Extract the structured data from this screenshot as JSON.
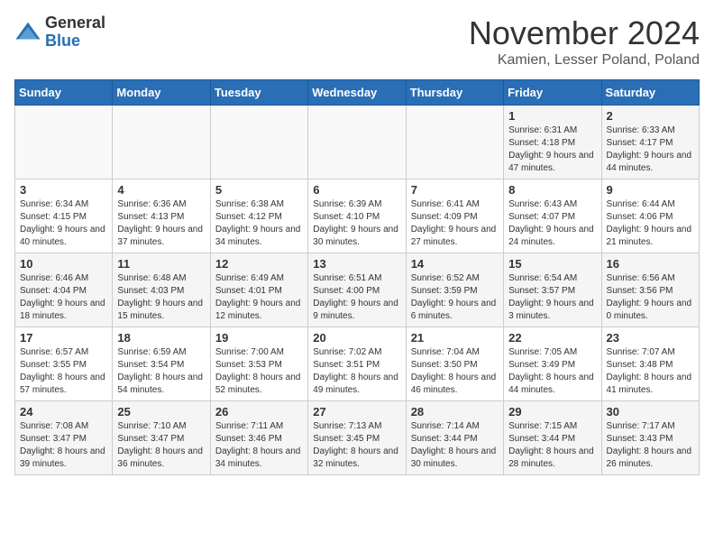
{
  "header": {
    "logo_general": "General",
    "logo_blue": "Blue",
    "month_title": "November 2024",
    "location": "Kamien, Lesser Poland, Poland"
  },
  "days_of_week": [
    "Sunday",
    "Monday",
    "Tuesday",
    "Wednesday",
    "Thursday",
    "Friday",
    "Saturday"
  ],
  "weeks": [
    [
      {
        "day": "",
        "info": ""
      },
      {
        "day": "",
        "info": ""
      },
      {
        "day": "",
        "info": ""
      },
      {
        "day": "",
        "info": ""
      },
      {
        "day": "",
        "info": ""
      },
      {
        "day": "1",
        "info": "Sunrise: 6:31 AM\nSunset: 4:18 PM\nDaylight: 9 hours and 47 minutes."
      },
      {
        "day": "2",
        "info": "Sunrise: 6:33 AM\nSunset: 4:17 PM\nDaylight: 9 hours and 44 minutes."
      }
    ],
    [
      {
        "day": "3",
        "info": "Sunrise: 6:34 AM\nSunset: 4:15 PM\nDaylight: 9 hours and 40 minutes."
      },
      {
        "day": "4",
        "info": "Sunrise: 6:36 AM\nSunset: 4:13 PM\nDaylight: 9 hours and 37 minutes."
      },
      {
        "day": "5",
        "info": "Sunrise: 6:38 AM\nSunset: 4:12 PM\nDaylight: 9 hours and 34 minutes."
      },
      {
        "day": "6",
        "info": "Sunrise: 6:39 AM\nSunset: 4:10 PM\nDaylight: 9 hours and 30 minutes."
      },
      {
        "day": "7",
        "info": "Sunrise: 6:41 AM\nSunset: 4:09 PM\nDaylight: 9 hours and 27 minutes."
      },
      {
        "day": "8",
        "info": "Sunrise: 6:43 AM\nSunset: 4:07 PM\nDaylight: 9 hours and 24 minutes."
      },
      {
        "day": "9",
        "info": "Sunrise: 6:44 AM\nSunset: 4:06 PM\nDaylight: 9 hours and 21 minutes."
      }
    ],
    [
      {
        "day": "10",
        "info": "Sunrise: 6:46 AM\nSunset: 4:04 PM\nDaylight: 9 hours and 18 minutes."
      },
      {
        "day": "11",
        "info": "Sunrise: 6:48 AM\nSunset: 4:03 PM\nDaylight: 9 hours and 15 minutes."
      },
      {
        "day": "12",
        "info": "Sunrise: 6:49 AM\nSunset: 4:01 PM\nDaylight: 9 hours and 12 minutes."
      },
      {
        "day": "13",
        "info": "Sunrise: 6:51 AM\nSunset: 4:00 PM\nDaylight: 9 hours and 9 minutes."
      },
      {
        "day": "14",
        "info": "Sunrise: 6:52 AM\nSunset: 3:59 PM\nDaylight: 9 hours and 6 minutes."
      },
      {
        "day": "15",
        "info": "Sunrise: 6:54 AM\nSunset: 3:57 PM\nDaylight: 9 hours and 3 minutes."
      },
      {
        "day": "16",
        "info": "Sunrise: 6:56 AM\nSunset: 3:56 PM\nDaylight: 9 hours and 0 minutes."
      }
    ],
    [
      {
        "day": "17",
        "info": "Sunrise: 6:57 AM\nSunset: 3:55 PM\nDaylight: 8 hours and 57 minutes."
      },
      {
        "day": "18",
        "info": "Sunrise: 6:59 AM\nSunset: 3:54 PM\nDaylight: 8 hours and 54 minutes."
      },
      {
        "day": "19",
        "info": "Sunrise: 7:00 AM\nSunset: 3:53 PM\nDaylight: 8 hours and 52 minutes."
      },
      {
        "day": "20",
        "info": "Sunrise: 7:02 AM\nSunset: 3:51 PM\nDaylight: 8 hours and 49 minutes."
      },
      {
        "day": "21",
        "info": "Sunrise: 7:04 AM\nSunset: 3:50 PM\nDaylight: 8 hours and 46 minutes."
      },
      {
        "day": "22",
        "info": "Sunrise: 7:05 AM\nSunset: 3:49 PM\nDaylight: 8 hours and 44 minutes."
      },
      {
        "day": "23",
        "info": "Sunrise: 7:07 AM\nSunset: 3:48 PM\nDaylight: 8 hours and 41 minutes."
      }
    ],
    [
      {
        "day": "24",
        "info": "Sunrise: 7:08 AM\nSunset: 3:47 PM\nDaylight: 8 hours and 39 minutes."
      },
      {
        "day": "25",
        "info": "Sunrise: 7:10 AM\nSunset: 3:47 PM\nDaylight: 8 hours and 36 minutes."
      },
      {
        "day": "26",
        "info": "Sunrise: 7:11 AM\nSunset: 3:46 PM\nDaylight: 8 hours and 34 minutes."
      },
      {
        "day": "27",
        "info": "Sunrise: 7:13 AM\nSunset: 3:45 PM\nDaylight: 8 hours and 32 minutes."
      },
      {
        "day": "28",
        "info": "Sunrise: 7:14 AM\nSunset: 3:44 PM\nDaylight: 8 hours and 30 minutes."
      },
      {
        "day": "29",
        "info": "Sunrise: 7:15 AM\nSunset: 3:44 PM\nDaylight: 8 hours and 28 minutes."
      },
      {
        "day": "30",
        "info": "Sunrise: 7:17 AM\nSunset: 3:43 PM\nDaylight: 8 hours and 26 minutes."
      }
    ]
  ]
}
